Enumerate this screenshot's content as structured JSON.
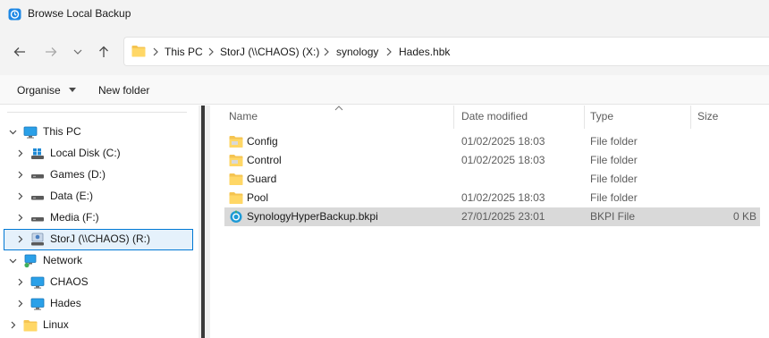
{
  "window": {
    "title": "Browse Local Backup"
  },
  "nav": {
    "back": "arrow-left-icon",
    "forward": "arrow-right-icon",
    "recent": "chevron-down-icon",
    "up": "arrow-up-icon"
  },
  "address": {
    "crumbs": [
      "This PC",
      "StorJ (\\\\CHAOS) (X:)",
      "synology",
      "Hades.hbk"
    ]
  },
  "toolbar": {
    "organise_label": "Organise",
    "new_folder_label": "New folder"
  },
  "navpane": {
    "items": [
      {
        "label": "This PC",
        "icon": "monitor-icon",
        "expanded": true
      },
      {
        "label": "Local Disk (C:)",
        "icon": "windows-drive-icon"
      },
      {
        "label": "Games (D:)",
        "icon": "drive-icon"
      },
      {
        "label": "Data (E:)",
        "icon": "drive-icon"
      },
      {
        "label": "Media (F:)",
        "icon": "drive-icon"
      },
      {
        "label": "StorJ (\\\\CHAOS) (R:)",
        "icon": "network-drive-icon",
        "selected": true
      },
      {
        "label": "Network",
        "icon": "network-icon",
        "expanded": true
      },
      {
        "label": "CHAOS",
        "icon": "monitor-icon"
      },
      {
        "label": "Hades",
        "icon": "monitor-icon"
      },
      {
        "label": "Linux",
        "icon": "folder-icon"
      }
    ]
  },
  "columns": {
    "name": "Name",
    "date": "Date modified",
    "type": "Type",
    "size": "Size"
  },
  "files": [
    {
      "name": "Config",
      "date": "01/02/2025 18:03",
      "type": "File folder",
      "size": "",
      "icon": "folder-icon"
    },
    {
      "name": "Control",
      "date": "01/02/2025 18:03",
      "type": "File folder",
      "size": "",
      "icon": "folder-icon"
    },
    {
      "name": "Guard",
      "date": "",
      "type": "File folder",
      "size": "",
      "icon": "folder-icon"
    },
    {
      "name": "Pool",
      "date": "01/02/2025 18:03",
      "type": "File folder",
      "size": "",
      "icon": "folder-icon"
    },
    {
      "name": "SynologyHyperBackup.bkpi",
      "date": "27/01/2025 23:01",
      "type": "BKPI File",
      "size": "0 KB",
      "icon": "backup-file-icon",
      "selected": true
    }
  ],
  "colors": {
    "accent": "#0078d4",
    "selected_row": "#d9d9d9",
    "selected_nav": "#e5f1fb",
    "folder": "#f5c451"
  }
}
